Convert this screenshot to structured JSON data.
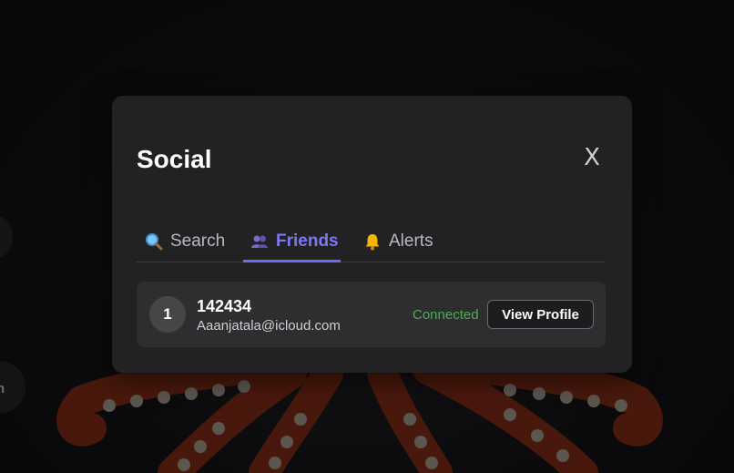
{
  "modal": {
    "title": "Social",
    "close_label": "X"
  },
  "tabs": [
    {
      "label": "Search",
      "icon": "magnifier-icon",
      "active": false
    },
    {
      "label": "Friends",
      "icon": "people-icon",
      "active": true
    },
    {
      "label": "Alerts",
      "icon": "bell-icon",
      "active": false
    }
  ],
  "friends": [
    {
      "rank": "1",
      "name": "142434",
      "email": "Aaanjatala@icloud.com",
      "status": "Connected",
      "action_label": "View Profile"
    }
  ],
  "background": {
    "side_letter": "n"
  },
  "colors": {
    "accent": "#6d6bf0",
    "status_connected": "#4bae4f",
    "modal_bg": "#222224",
    "card_bg": "#2e2e31"
  }
}
